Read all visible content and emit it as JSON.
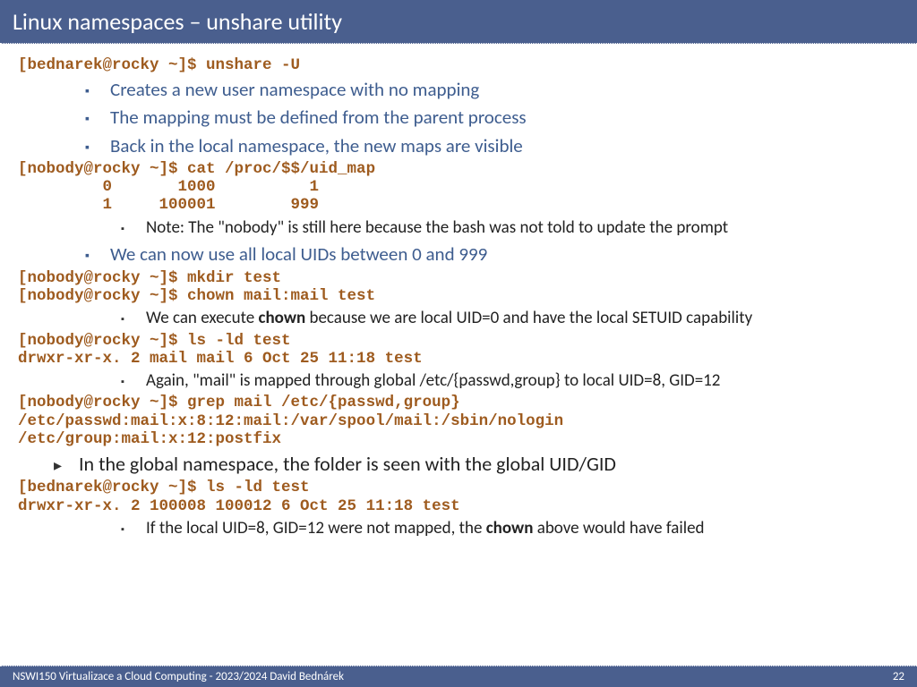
{
  "title": "Linux namespaces – unshare utility",
  "code1": "[bednarek@rocky ~]$ unshare -U",
  "b1": "Creates a new user namespace with no mapping",
  "b2": "The mapping must be defined from the parent process",
  "b3": "Back in the local namespace, the new maps are visible",
  "code2": "[nobody@rocky ~]$ cat /proc/$$/uid_map\n         0       1000          1\n         1     100001        999",
  "n1": "Note: The \"nobody\" is still here because the bash was not told to update the prompt",
  "b4": "We can now use all local UIDs between 0 and 999",
  "code3": "[nobody@rocky ~]$ mkdir test\n[nobody@rocky ~]$ chown mail:mail test",
  "n2a": "We can execute ",
  "n2b": "chown",
  "n2c": " because we are local UID=0 and have the local SETUID capability",
  "code4": "[nobody@rocky ~]$ ls -ld test\ndrwxr-xr-x. 2 mail mail 6 Oct 25 11:18 test",
  "n3": "Again, \"mail\" is mapped through global /etc/{passwd,group} to local UID=8, GID=12",
  "code5": "[nobody@rocky ~]$ grep mail /etc/{passwd,group}\n/etc/passwd:mail:x:8:12:mail:/var/spool/mail:/sbin/nologin\n/etc/group:mail:x:12:postfix",
  "t1": "In the global namespace, the folder is seen with the global UID/GID",
  "code6": "[bednarek@rocky ~]$ ls -ld test\ndrwxr-xr-x. 2 100008 100012 6 Oct 25 11:18 test",
  "n4a": "If the local UID=8, GID=12 were not mapped, the ",
  "n4b": "chown",
  "n4c": " above would have failed",
  "footer_left": "NSWI150 Virtualizace a Cloud Computing - 2023/2024 David Bednárek",
  "footer_right": "22"
}
